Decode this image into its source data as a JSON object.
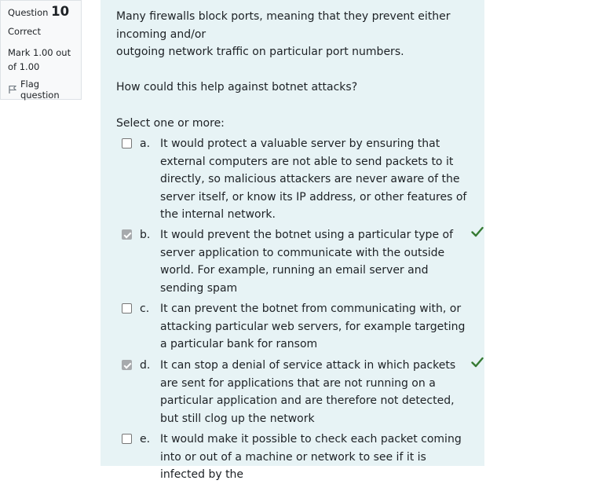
{
  "info": {
    "question_label": "Question",
    "question_number": "10",
    "state": "Correct",
    "grade": "Mark 1.00 out of 1.00",
    "flag_label": "Flag question"
  },
  "question": {
    "line1": "Many firewalls block ports, meaning that they prevent either incoming and/or",
    "line2": "outgoing network traffic on particular port numbers.",
    "line3": "How could this help against botnet attacks?",
    "prompt": "Select one or more:"
  },
  "options": [
    {
      "letter": "a.",
      "text": "It would protect a valuable server by ensuring that external computers are not able to send packets to it directly, so malicious attackers are never aware of the server itself, or know its IP address, or other features of the internal network.",
      "checked": false,
      "correct": false
    },
    {
      "letter": "b.",
      "text": "It would prevent the botnet using a particular type of server application to communicate with the outside world. For example, running an email server and sending spam",
      "checked": true,
      "correct": true
    },
    {
      "letter": "c.",
      "text": "It can prevent the botnet from communicating with, or attacking particular web servers, for example targeting a particular bank for ransom",
      "checked": false,
      "correct": false
    },
    {
      "letter": "d.",
      "text": "It can stop a denial of service attack in which packets are sent for applications that are not running on a particular application and are therefore not detected, but still clog up the network",
      "checked": true,
      "correct": true
    },
    {
      "letter": "e.",
      "text": "It would make it possible to check each packet coming into or out of a machine or network to see if it is infected by the",
      "checked": false,
      "correct": false
    }
  ],
  "colors": {
    "formulation_bg": "#e7f3f5",
    "correct_tick": "#357a32",
    "info_bg": "#f8f9fa"
  }
}
